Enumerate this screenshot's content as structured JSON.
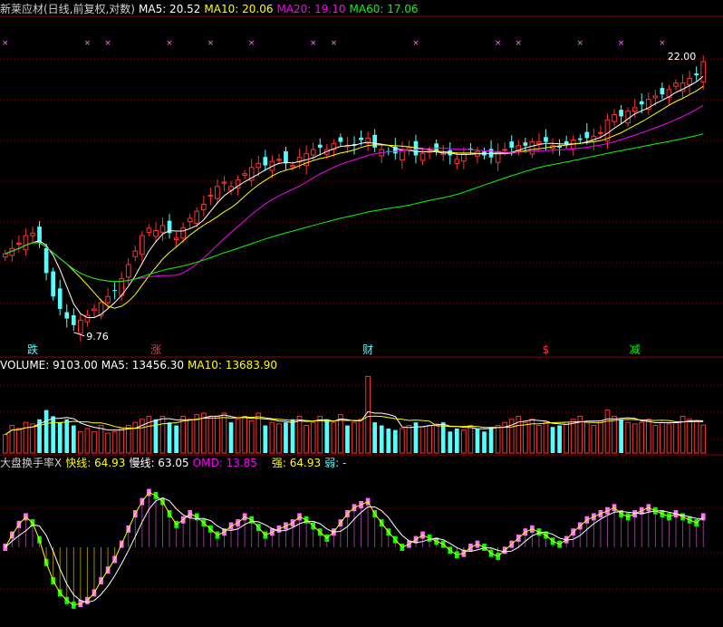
{
  "colors": {
    "up": "#ff3232",
    "down": "#54ffff",
    "ma5": "#ffffff",
    "ma10": "#ffff00",
    "ma20": "#ff00ff",
    "ma60": "#00ff00",
    "grid": "#8b0000",
    "upvol": "#ff3232",
    "downvol": "#54ffff",
    "green": "#00ff00",
    "magenta": "#ff70ff"
  },
  "header": {
    "title": "新莱应材(日线,前复权,对数)",
    "ma5": "MA5: 20.52",
    "ma10": "MA10: 20.06",
    "ma20": "MA20: 19.10",
    "ma60": "MA60: 17.06"
  },
  "volume_header": {
    "title": "VOLUME: 9103.00",
    "ma5": "MA5: 13456.30",
    "ma10": "MA10: 13683.90"
  },
  "indicator_header": {
    "title": "大盘换手率X",
    "fast": "快线: 64.93",
    "slow": "慢线: 63.05",
    "omd": "OMD: 13.85",
    "strong": "强: 64.93",
    "weak": "弱: -"
  },
  "annotations": {
    "high_label": "22.00",
    "low_label": "9.76",
    "markers": [
      {
        "text": "跌",
        "color": "#54ffff",
        "idx": 4
      },
      {
        "text": "涨",
        "color": "#ff3232",
        "idx": 22
      },
      {
        "text": "财",
        "color": "#54ffff",
        "idx": 53
      },
      {
        "text": "$",
        "color": "#ff3232",
        "idx": 79
      },
      {
        "text": "减",
        "color": "#00ff00",
        "idx": 92
      }
    ]
  },
  "chart_data": {
    "type": "candlestick",
    "price_log_scale": true,
    "price_range": [
      9.5,
      22.5
    ],
    "last_close": 22.0,
    "closes": [
      12.2,
      12.4,
      12.6,
      12.9,
      13.0,
      12.6,
      11.5,
      10.7,
      10.3,
      10.0,
      9.8,
      9.95,
      10.1,
      10.3,
      10.5,
      10.7,
      10.9,
      11.3,
      11.8,
      12.3,
      12.9,
      13.2,
      13.1,
      13.3,
      13.0,
      12.8,
      13.2,
      13.6,
      13.9,
      14.2,
      14.6,
      15.0,
      15.2,
      15.0,
      15.3,
      15.6,
      15.9,
      16.1,
      16.0,
      16.2,
      16.3,
      16.1,
      16.0,
      16.4,
      16.6,
      16.8,
      16.9,
      16.8,
      17.1,
      17.2,
      17.0,
      17.0,
      17.3,
      17.4,
      16.9,
      16.8,
      16.7,
      16.6,
      16.8,
      16.9,
      16.5,
      16.6,
      16.7,
      16.7,
      16.6,
      16.5,
      16.3,
      16.6,
      16.8,
      16.7,
      16.5,
      16.4,
      16.7,
      16.8,
      16.9,
      17.0,
      17.0,
      17.2,
      17.2,
      17.2,
      17.0,
      16.9,
      17.1,
      17.3,
      17.3,
      17.4,
      17.5,
      17.7,
      18.4,
      18.7,
      18.6,
      18.9,
      19.1,
      19.3,
      19.6,
      19.8,
      19.9,
      20.2,
      20.6,
      20.6,
      20.9,
      21.1,
      22.0
    ],
    "volume_range": [
      0,
      26000
    ],
    "volumes": [
      6000,
      9000,
      8000,
      10000,
      9500,
      11000,
      14000,
      12000,
      10000,
      11000,
      9000,
      7000,
      8000,
      7000,
      9000,
      6500,
      7000,
      8000,
      9000,
      10000,
      11000,
      12000,
      11000,
      12000,
      10000,
      9000,
      12000,
      11000,
      12500,
      13000,
      11500,
      12000,
      13000,
      10000,
      11000,
      12000,
      10500,
      13000,
      9000,
      10000,
      9500,
      10000,
      11000,
      12000,
      9000,
      10000,
      12000,
      11000,
      10000,
      12500,
      9000,
      10000,
      11000,
      25000,
      10000,
      9000,
      8000,
      7500,
      8000,
      9000,
      10000,
      8500,
      9000,
      9500,
      10000,
      7000,
      8000,
      7500,
      9000,
      8000,
      7000,
      8500,
      9000,
      10000,
      11000,
      12000,
      10000,
      11000,
      9000,
      10000,
      8500,
      9000,
      10000,
      11000,
      12000,
      10000,
      9000,
      10500,
      14000,
      12000,
      11000,
      10000,
      9500,
      10000,
      11000,
      9000,
      10000,
      9500,
      10000,
      12000,
      11000,
      10500,
      9103
    ],
    "indicator_range": [
      0,
      100
    ],
    "fast_line": [
      50,
      58,
      65,
      70,
      66,
      55,
      40,
      28,
      20,
      15,
      12,
      13,
      15,
      20,
      28,
      35,
      42,
      52,
      62,
      72,
      80,
      86,
      84,
      80,
      72,
      65,
      68,
      72,
      70,
      66,
      62,
      58,
      60,
      64,
      66,
      70,
      68,
      63,
      58,
      60,
      62,
      64,
      66,
      70,
      68,
      64,
      60,
      56,
      60,
      66,
      72,
      76,
      78,
      80,
      72,
      66,
      60,
      55,
      50,
      52,
      55,
      58,
      56,
      54,
      52,
      48,
      45,
      46,
      50,
      52,
      50,
      46,
      44,
      48,
      52,
      56,
      60,
      62,
      60,
      58,
      54,
      52,
      55,
      60,
      64,
      68,
      70,
      72,
      74,
      76,
      72,
      70,
      72,
      74,
      76,
      74,
      72,
      70,
      72,
      70,
      68,
      66,
      70
    ]
  }
}
